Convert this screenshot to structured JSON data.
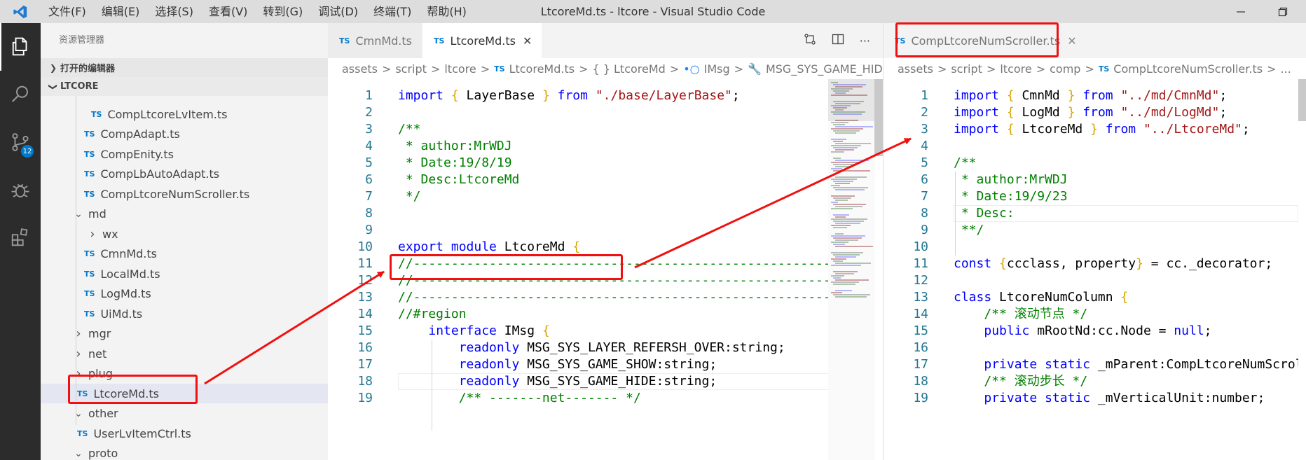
{
  "titlebar": {
    "menu": [
      "文件(F)",
      "编辑(E)",
      "选择(S)",
      "查看(V)",
      "转到(G)",
      "调试(D)",
      "终端(T)",
      "帮助(H)"
    ],
    "title": "LtcoreMd.ts - ltcore - Visual Studio Code"
  },
  "activitybar": {
    "scm_badge": "12"
  },
  "sidebar": {
    "title": "资源管理器",
    "open_editors": "打开的编辑器",
    "project": "LTCORE",
    "file_badge": "TS",
    "tree": [
      {
        "label": "CompLtcoreLvItem.ts",
        "kind": "ts"
      },
      {
        "label": "CompAdapt.ts",
        "kind": "ts"
      },
      {
        "label": "CompEnity.ts",
        "kind": "ts"
      },
      {
        "label": "CompLbAutoAdapt.ts",
        "kind": "ts"
      },
      {
        "label": "CompLtcoreNumScroller.ts",
        "kind": "ts"
      },
      {
        "label": "md",
        "kind": "folder-open"
      },
      {
        "label": "wx",
        "kind": "folder"
      },
      {
        "label": "CmnMd.ts",
        "kind": "ts"
      },
      {
        "label": "LocalMd.ts",
        "kind": "ts"
      },
      {
        "label": "LogMd.ts",
        "kind": "ts"
      },
      {
        "label": "UiMd.ts",
        "kind": "ts"
      },
      {
        "label": "mgr",
        "kind": "folder"
      },
      {
        "label": "net",
        "kind": "folder"
      },
      {
        "label": "plug",
        "kind": "folder"
      },
      {
        "label": "LtcoreMd.ts",
        "kind": "ts"
      },
      {
        "label": "other",
        "kind": "folder-open"
      },
      {
        "label": "UserLvItemCtrl.ts",
        "kind": "ts"
      },
      {
        "label": "proto",
        "kind": "folder-open"
      }
    ]
  },
  "editor1": {
    "tabs": [
      {
        "label": "CmnMd.ts",
        "active": false
      },
      {
        "label": "LtcoreMd.ts",
        "active": true
      }
    ],
    "breadcrumb": [
      "assets",
      "script",
      "ltcore",
      "LtcoreMd.ts",
      "{ } LtcoreMd",
      "IMsg",
      "MSG_SYS_GAME_HIDE"
    ],
    "lines": [
      {
        "n": "1",
        "text": "import { LayerBase } from \"./base/LayerBase\";"
      },
      {
        "n": "2",
        "text": ""
      },
      {
        "n": "3",
        "text": "/**"
      },
      {
        "n": "4",
        "text": " * author:MrWDJ"
      },
      {
        "n": "5",
        "text": " * Date:19/8/19"
      },
      {
        "n": "6",
        "text": " * Desc:LtcoreMd"
      },
      {
        "n": "7",
        "text": " */"
      },
      {
        "n": "8",
        "text": ""
      },
      {
        "n": "9",
        "text": ""
      },
      {
        "n": "10",
        "text": "export module LtcoreMd {"
      },
      {
        "n": "11",
        "text": "//------------------------------------------------------------"
      },
      {
        "n": "12",
        "text": "//------------------------------------------------------------"
      },
      {
        "n": "13",
        "text": "//------------------------------------------------------------"
      },
      {
        "n": "14",
        "text": "//#region"
      },
      {
        "n": "15",
        "text": "    interface IMsg {"
      },
      {
        "n": "16",
        "text": "        readonly MSG_SYS_LAYER_REFERSH_OVER:string;"
      },
      {
        "n": "17",
        "text": "        readonly MSG_SYS_GAME_SHOW:string;"
      },
      {
        "n": "18",
        "text": "        readonly MSG_SYS_GAME_HIDE:string;"
      },
      {
        "n": "19",
        "text": "        /** -------net------- */"
      }
    ]
  },
  "editor2": {
    "tabs": [
      {
        "label": "CompLtcoreNumScroller.ts",
        "active": false
      }
    ],
    "breadcrumb": [
      "assets",
      "script",
      "ltcore",
      "comp",
      "CompLtcoreNumScroller.ts",
      "..."
    ],
    "lines": [
      {
        "n": "1",
        "text": "import { CmnMd } from \"../md/CmnMd\";"
      },
      {
        "n": "2",
        "text": "import { LogMd } from \"../md/LogMd\";"
      },
      {
        "n": "3",
        "text": "import { LtcoreMd } from \"../LtcoreMd\";"
      },
      {
        "n": "4",
        "text": ""
      },
      {
        "n": "5",
        "text": "/**"
      },
      {
        "n": "6",
        "text": " * author:MrWDJ"
      },
      {
        "n": "7",
        "text": " * Date:19/9/23"
      },
      {
        "n": "8",
        "text": " * Desc:"
      },
      {
        "n": "9",
        "text": " **/"
      },
      {
        "n": "10",
        "text": ""
      },
      {
        "n": "11",
        "text": "const {ccclass, property} = cc._decorator;"
      },
      {
        "n": "12",
        "text": ""
      },
      {
        "n": "13",
        "text": "class LtcoreNumColumn {"
      },
      {
        "n": "14",
        "text": "    /** 滚动节点 */"
      },
      {
        "n": "15",
        "text": "    public mRootNd:cc.Node = null;"
      },
      {
        "n": "16",
        "text": ""
      },
      {
        "n": "17",
        "text": "    private static _mParent:CompLtcoreNumScroller;"
      },
      {
        "n": "18",
        "text": "    /** 滚动步长 */"
      },
      {
        "n": "19",
        "text": "    private static _mVerticalUnit:number;"
      }
    ]
  }
}
